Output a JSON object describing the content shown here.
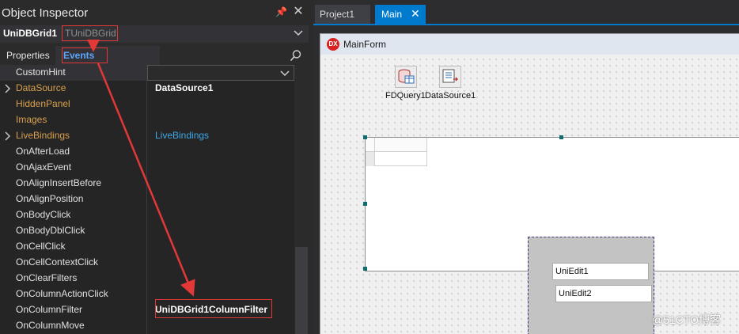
{
  "inspector": {
    "title": "Object Inspector",
    "component_name": "UniDBGrid1",
    "component_type": "TUniDBGrid",
    "tabs": {
      "properties": "Properties",
      "events": "Events"
    },
    "rows": [
      {
        "name": "CustomHint",
        "value": ""
      },
      {
        "name": "DataSource",
        "value": "DataSource1"
      },
      {
        "name": "HiddenPanel",
        "value": ""
      },
      {
        "name": "Images",
        "value": ""
      },
      {
        "name": "LiveBindings",
        "value": "LiveBindings"
      },
      {
        "name": "OnAfterLoad",
        "value": ""
      },
      {
        "name": "OnAjaxEvent",
        "value": ""
      },
      {
        "name": "OnAlignInsertBefore",
        "value": ""
      },
      {
        "name": "OnAlignPosition",
        "value": ""
      },
      {
        "name": "OnBodyClick",
        "value": ""
      },
      {
        "name": "OnBodyDblClick",
        "value": ""
      },
      {
        "name": "OnCellClick",
        "value": ""
      },
      {
        "name": "OnCellContextClick",
        "value": ""
      },
      {
        "name": "OnClearFilters",
        "value": ""
      },
      {
        "name": "OnColumnActionClick",
        "value": ""
      },
      {
        "name": "OnColumnFilter",
        "value": "UniDBGrid1ColumnFilter"
      },
      {
        "name": "OnColumnMove",
        "value": ""
      }
    ]
  },
  "designer": {
    "tabs": {
      "project": "Project1",
      "main": "Main"
    },
    "form_title": "MainForm",
    "form_icon_text": "DX",
    "components": {
      "query": "FDQuery1",
      "datasource": "DataSource1"
    },
    "edits": {
      "edit1": "UniEdit1",
      "edit2": "UniEdit2"
    }
  },
  "watermark": "@51CTO博客",
  "colors": {
    "annotation": "#e13838",
    "accent": "#007acc",
    "events_tab": "#59a7ff",
    "category": "#d9a04d",
    "link": "#3ea8e8"
  }
}
